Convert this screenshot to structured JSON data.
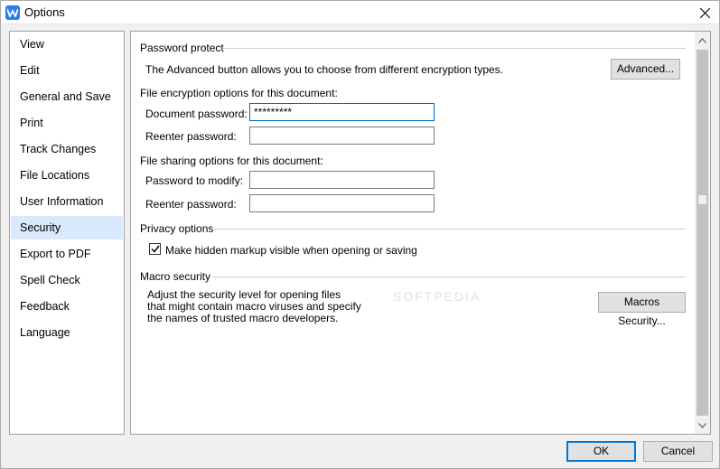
{
  "window": {
    "title": "Options"
  },
  "nav": {
    "items": [
      {
        "label": "View"
      },
      {
        "label": "Edit"
      },
      {
        "label": "General and Save"
      },
      {
        "label": "Print"
      },
      {
        "label": "Track Changes"
      },
      {
        "label": "File Locations"
      },
      {
        "label": "User Information"
      },
      {
        "label": "Security",
        "selected": true
      },
      {
        "label": "Export to PDF"
      },
      {
        "label": "Spell Check"
      },
      {
        "label": "Feedback"
      },
      {
        "label": "Language"
      }
    ]
  },
  "password_protect": {
    "heading": "Password protect",
    "description": "The Advanced button allows you to choose from different encryption types.",
    "advanced_label": "Advanced..."
  },
  "encryption": {
    "heading": "File encryption options for this document:",
    "doc_password_label": "Document password:",
    "doc_password_value": "*********",
    "reenter_label": "Reenter password:",
    "reenter_value": ""
  },
  "sharing": {
    "heading": "File sharing options for this document:",
    "modify_label": "Password to modify:",
    "modify_value": "",
    "reenter_label": "Reenter password:",
    "reenter_value": ""
  },
  "privacy": {
    "heading": "Privacy options",
    "markup_label": "Make hidden markup visible when opening or saving",
    "markup_checked": true
  },
  "macro": {
    "heading": "Macro security",
    "desc_line1": "Adjust the security level for opening files",
    "desc_line2": "that might contain macro viruses and specify",
    "desc_line3": "the names of trusted macro developers.",
    "button_label": "Macros Security..."
  },
  "footer": {
    "ok_label": "OK",
    "cancel_label": "Cancel"
  },
  "watermark": "SOFTPEDIA",
  "colors": {
    "accent": "#0078d7",
    "selected_bg": "#d9e8fb",
    "app_icon": "#2b7de9"
  }
}
